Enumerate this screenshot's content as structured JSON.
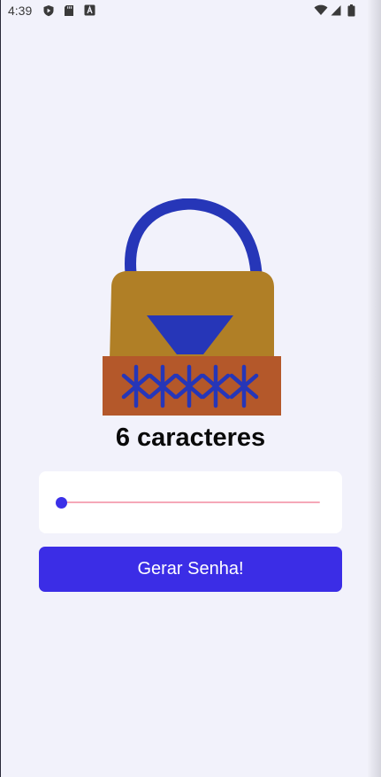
{
  "status_bar": {
    "time": "4:39",
    "left_icons": [
      "shield-play-icon",
      "sd-card-icon",
      "a-square-icon"
    ],
    "right_icons": [
      "wifi-icon",
      "cell-signal-icon",
      "battery-icon"
    ]
  },
  "main": {
    "char_count_text": "6 caracteres",
    "slider": {
      "value": 6,
      "fill_fraction": 0.02
    },
    "generate_button_label": "Gerar Senha!"
  },
  "colors": {
    "background": "#f2f2fb",
    "accent": "#3b2de6",
    "slider_inactive_track": "#f5a8b8",
    "lock_body": "#b07f26",
    "lock_base": "#b4582a",
    "lock_shackle": "#2636b8"
  }
}
